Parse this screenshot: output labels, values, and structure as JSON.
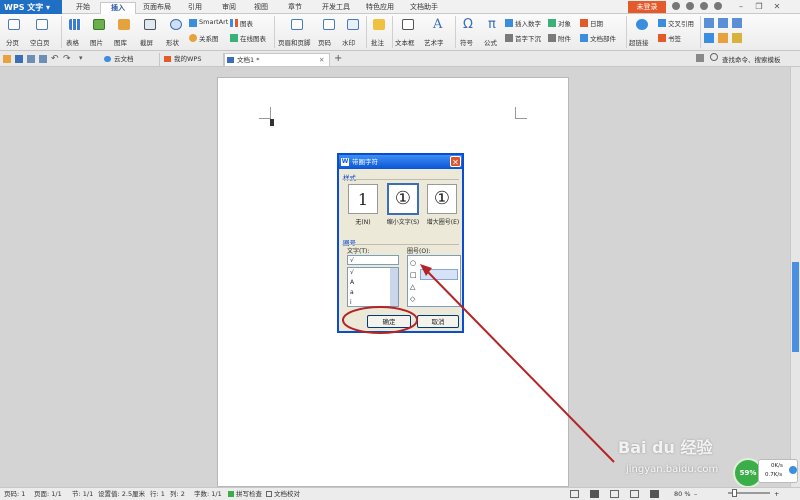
{
  "app": {
    "title": "WPS 文字"
  },
  "ribbon_tabs": [
    "开始",
    "插入",
    "页面布局",
    "引用",
    "审阅",
    "视图",
    "章节",
    "开发工具",
    "特色应用",
    "文档助手"
  ],
  "active_tab": "插入",
  "login_label": "未登录",
  "window_controls": {
    "minimize": "–",
    "restore": "❐",
    "close": "✕"
  },
  "ribbon": {
    "page_break": "分页",
    "blank_page": "空白页",
    "table": "表格",
    "picture": "图片",
    "gallery": "图库",
    "screenshot": "截屏",
    "shapes": "形状",
    "smartart": "SmartArt",
    "relation": "关系图",
    "chart": "图表",
    "online_chart": "在线图表",
    "header_footer": "页眉和页脚",
    "page_number": "页码",
    "watermark": "水印",
    "comment": "批注",
    "textbox": "文本框",
    "wordart": "艺术字",
    "symbol": "符号",
    "formula": "公式",
    "insert_number": "插入数字",
    "object": "对象",
    "date": "日期",
    "dropcap": "首字下沉",
    "attachment": "附件",
    "doc_parts": "文档部件",
    "hyperlink": "超链接",
    "cross_ref": "交叉引用",
    "bookmark": "书签"
  },
  "doc_tabs": [
    {
      "label": "云文档"
    },
    {
      "label": "我的WPS"
    },
    {
      "label": "文档1 *"
    }
  ],
  "tab_add": "+",
  "right_tools": {
    "find": "查找命令、搜索模板"
  },
  "dialog": {
    "title": "带圈字符",
    "style_group": "样式",
    "styles": [
      {
        "glyph": "1",
        "label": "无(N)"
      },
      {
        "glyph": "①",
        "label": "缩小文字(S)"
      },
      {
        "glyph": "①",
        "label": "增大圈号(E)"
      }
    ],
    "circle_group": "圈号",
    "text_label": "文字(T):",
    "text_value": "√",
    "text_items": [
      "√",
      "A",
      "a",
      "i"
    ],
    "enclosure_label": "圈号(O):",
    "enclosures": [
      "○",
      "□",
      "△",
      "◇"
    ],
    "ok": "确定",
    "cancel": "取消"
  },
  "status": {
    "page": "页码: 1",
    "pages": "页面: 1/1",
    "section": "节: 1/1",
    "setting": "设置值: 2.5厘米",
    "line": "行: 1",
    "column": "列: 2",
    "words": "字数: 1/1",
    "spell": "拼写检查",
    "proof": "文档校对",
    "zoom": "80 %"
  },
  "net": {
    "up": "0K/s",
    "down": "0.7K/s",
    "percent": "59%"
  },
  "watermark": {
    "brand": "Bai du 经验",
    "url": "jingyan.baidu.com"
  },
  "colors": {
    "accent": "#1f6fc5",
    "dialog_title": "#0a55d6",
    "highlight": "#b52424"
  }
}
